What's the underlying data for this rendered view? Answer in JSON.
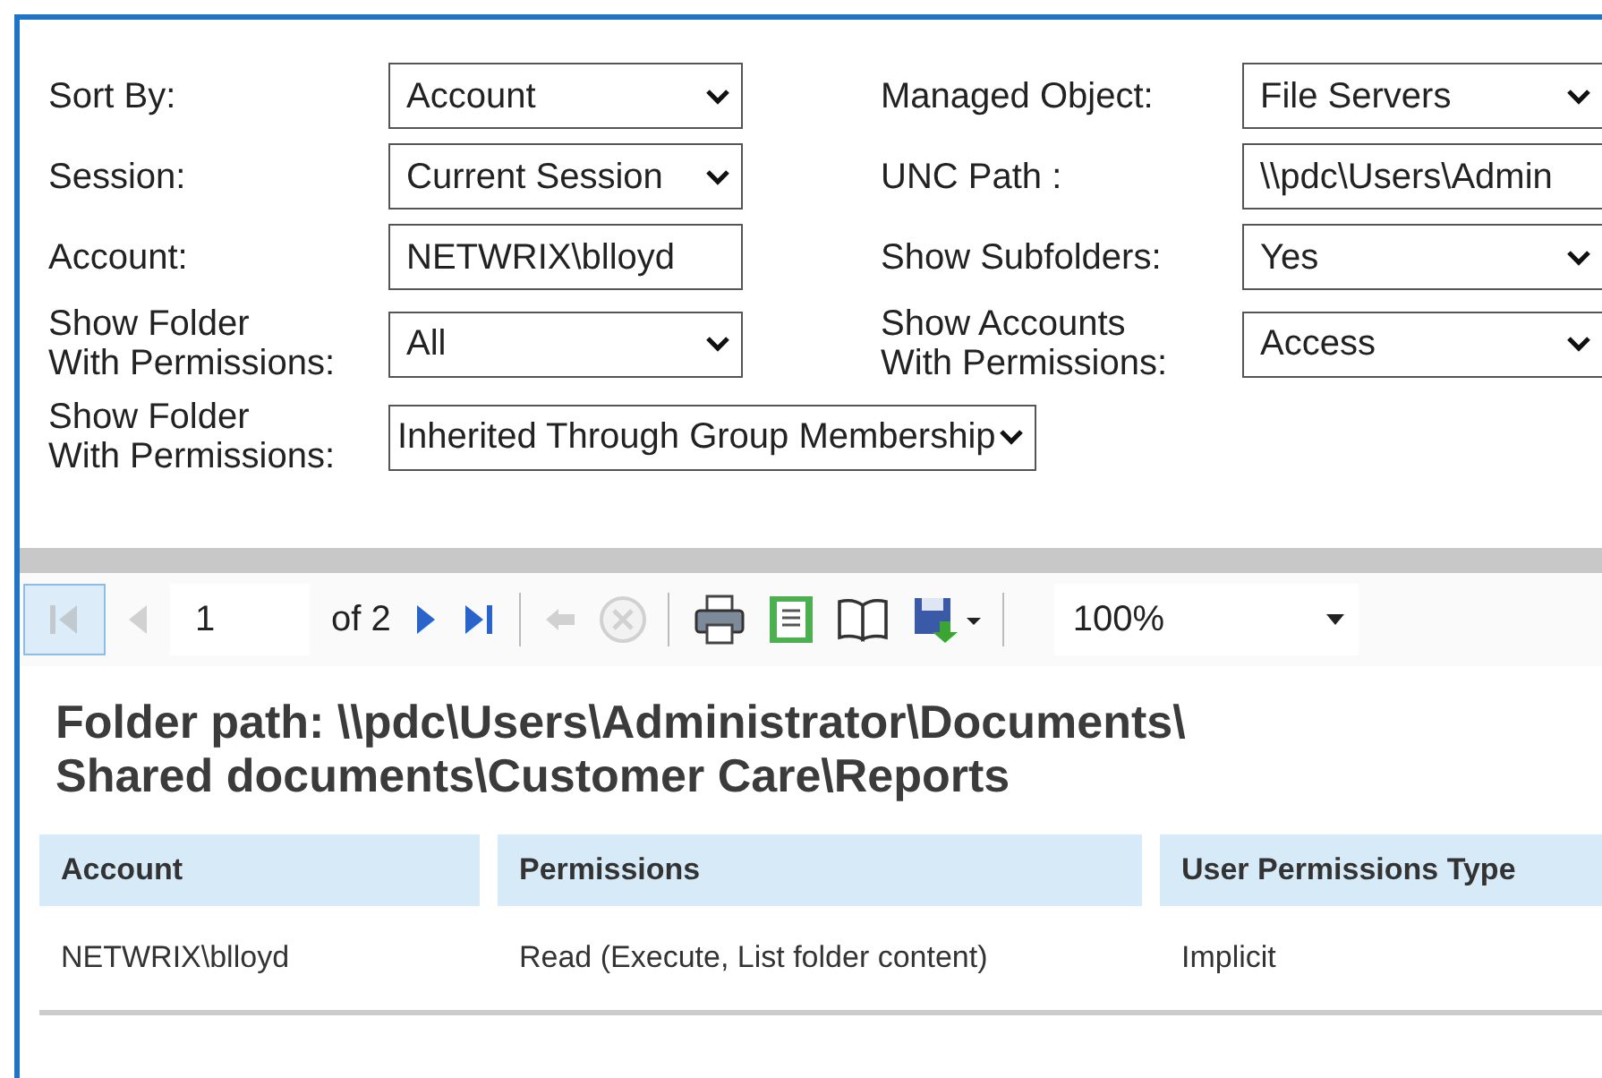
{
  "filters": [
    {
      "cells": [
        {
          "label": "Sort By:",
          "kind": "select",
          "value": "Account"
        },
        {
          "label": "Managed Object:",
          "kind": "select",
          "value": "File Servers"
        }
      ]
    },
    {
      "cells": [
        {
          "label": "Session:",
          "kind": "select",
          "value": "Current Session"
        },
        {
          "label": "UNC Path :",
          "kind": "text",
          "value": "\\\\pdc\\Users\\Admin"
        }
      ]
    },
    {
      "cells": [
        {
          "label": "Account:",
          "kind": "text",
          "value": "NETWRIX\\blloyd"
        },
        {
          "label": "Show Subfolders:",
          "kind": "select",
          "value": "Yes"
        }
      ]
    },
    {
      "cells": [
        {
          "label": "Show Folder With Permissions:",
          "kind": "select",
          "value": "All"
        },
        {
          "label": "Show Accounts With Permissions:",
          "kind": "select",
          "value": "Access"
        }
      ]
    },
    {
      "cells": [
        {
          "label": "Show Folder With Permissions:",
          "kind": "select",
          "value": "Inherited Through Group Membership"
        }
      ]
    }
  ],
  "toolbar": {
    "page": "1",
    "page_count": "of 2",
    "zoom": "100%",
    "buttons": [
      {
        "kind": "first",
        "disabled": true,
        "highlighted": true
      },
      {
        "kind": "previous",
        "disabled": true,
        "highlighted": false
      },
      {
        "kind": "page"
      },
      {
        "kind": "next",
        "disabled": false,
        "highlighted": false
      },
      {
        "kind": "last",
        "disabled": false,
        "highlighted": false
      },
      {
        "kind": "separator"
      },
      {
        "kind": "back",
        "disabled": true,
        "highlighted": false
      },
      {
        "kind": "stop",
        "disabled": true,
        "highlighted": false
      },
      {
        "kind": "separator"
      },
      {
        "kind": "print",
        "disabled": false,
        "highlighted": false
      },
      {
        "kind": "layout",
        "disabled": false,
        "highlighted": false
      },
      {
        "kind": "page-setup",
        "disabled": false,
        "highlighted": false
      },
      {
        "kind": "export",
        "disabled": false,
        "highlighted": false
      },
      {
        "kind": "separator"
      },
      {
        "kind": "zoom"
      }
    ]
  },
  "report": {
    "title": "Folder path:  \\\\pdc\\Users\\Administrator\\Documents\\ Shared documents\\Customer Care\\Reports",
    "table": {
      "columns": [
        "Account",
        "Permissions",
        "User Permissions Type"
      ],
      "rows": [
        [
          "NETWRIX\\blloyd",
          "Read (Execute, List folder content)",
          "Implicit"
        ]
      ]
    }
  }
}
